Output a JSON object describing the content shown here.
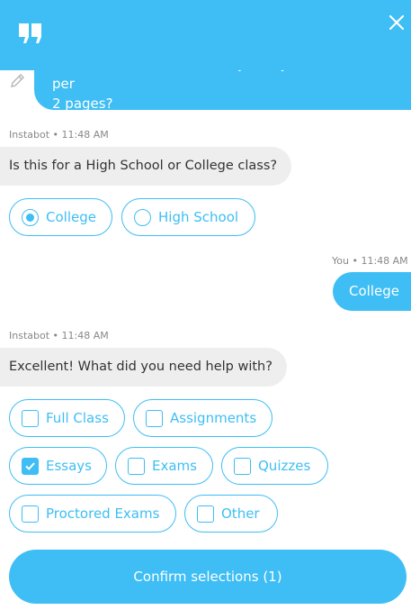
{
  "header": {
    "logo_icon": "quote-logo-icon",
    "close_icon": "close-icon",
    "color": "#3ebef4"
  },
  "messages": {
    "user_first": {
      "line1": "Hello, I want to order a story essay. How much is per",
      "line2": "2 pages?"
    },
    "bot1": {
      "meta": "Instabot • 11:48 AM",
      "text": "Is this for a High School or College class?"
    },
    "user_reply": {
      "meta": "You • 11:48 AM",
      "text": "College"
    },
    "bot2": {
      "meta": "Instabot • 11:48 AM",
      "text": "Excellent! What did you need help with?"
    }
  },
  "level_options": [
    {
      "label": "College",
      "selected": true
    },
    {
      "label": "High School",
      "selected": false
    }
  ],
  "help_options": [
    {
      "label": "Full Class",
      "checked": false
    },
    {
      "label": "Assignments",
      "checked": false
    },
    {
      "label": "Essays",
      "checked": true
    },
    {
      "label": "Exams",
      "checked": false
    },
    {
      "label": "Quizzes",
      "checked": false
    },
    {
      "label": "Proctored Exams",
      "checked": false
    },
    {
      "label": "Other",
      "checked": false
    }
  ],
  "confirm_label": "Confirm selections (1)"
}
